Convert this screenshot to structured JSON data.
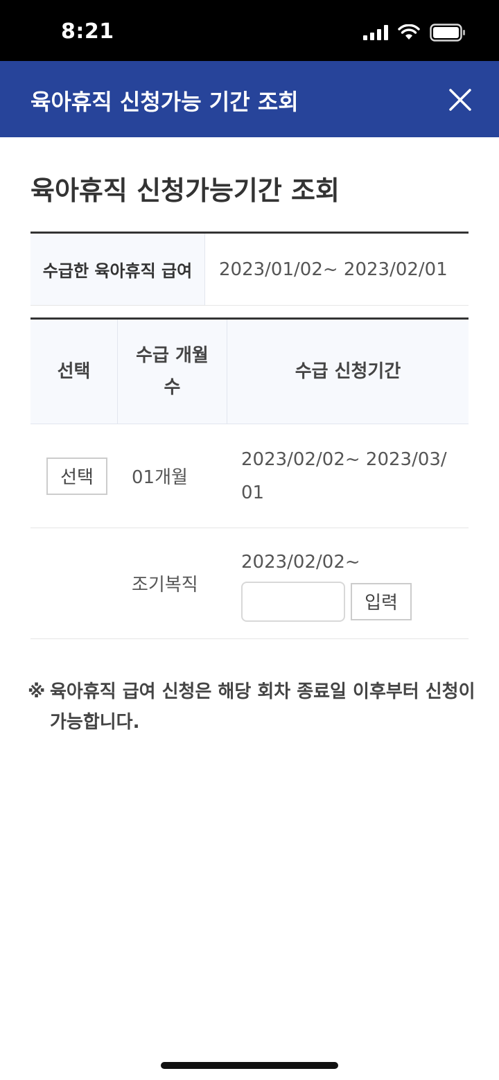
{
  "status_bar": {
    "time": "8:21"
  },
  "header": {
    "title": "육아휴직 신청가능 기간 조회"
  },
  "page": {
    "title": "육아휴직 신청가능기간 조회"
  },
  "summary": {
    "label": "수급한 육아휴직 급여",
    "value": "2023/01/02~ 2023/02/01"
  },
  "table": {
    "headers": {
      "select": "선택",
      "months": "수급 개월 수",
      "period": "수급 신청기간"
    },
    "rows": [
      {
        "select_label": "선택",
        "months": "01개월",
        "period": "2023/02/02~ 2023/03/01"
      }
    ],
    "early_return": {
      "label": "조기복직",
      "start_date": "2023/02/02~",
      "input_value": "",
      "input_button": "입력"
    }
  },
  "notice": {
    "mark": "※",
    "text": "육아휴직 급여 신청은 해당 회차 종료일 이후부터 신청이 가능합니다."
  }
}
